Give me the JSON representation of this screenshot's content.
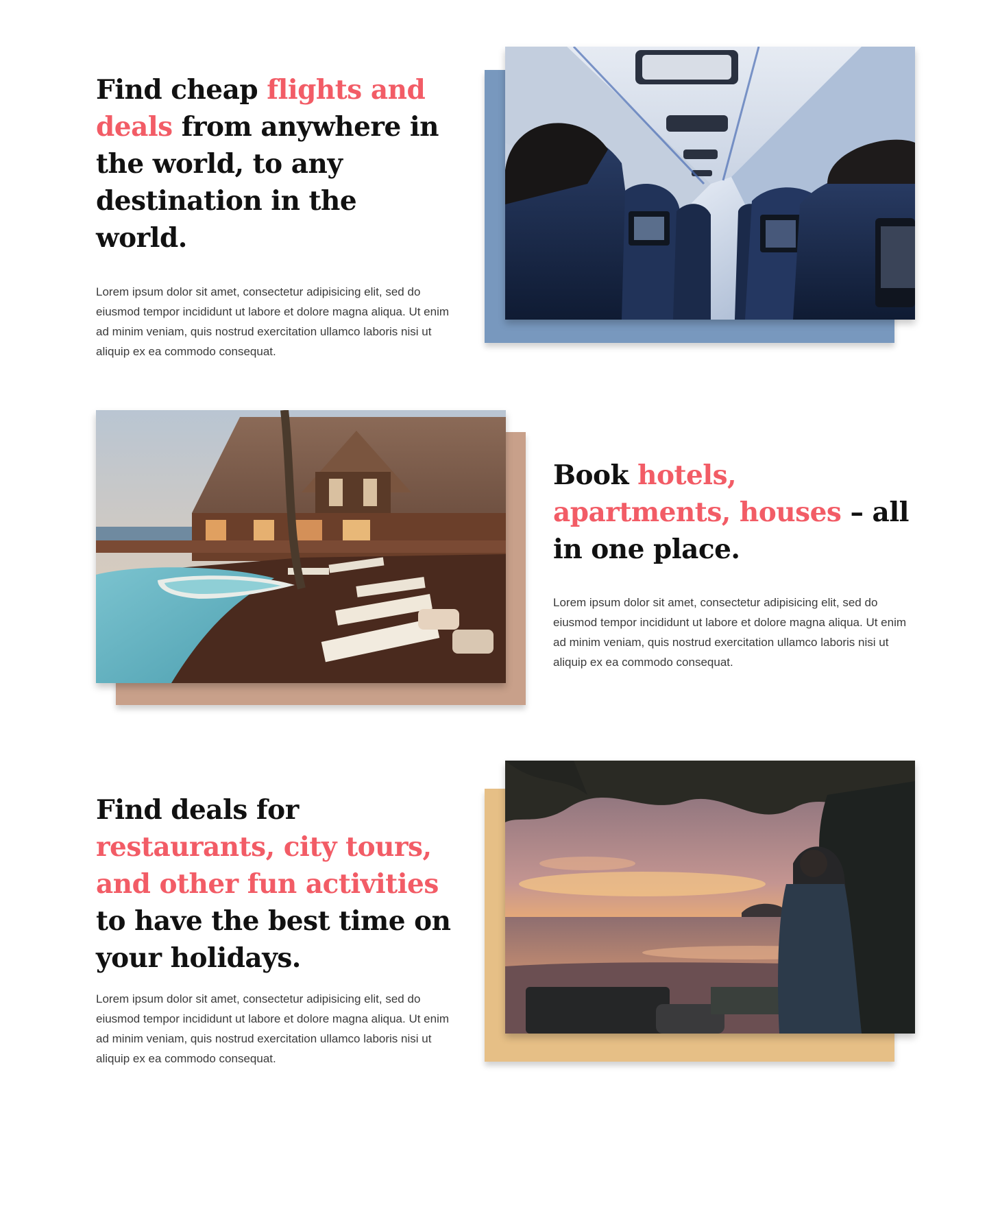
{
  "features": [
    {
      "heading_start": "Find cheap ",
      "heading_accent": "flights and deals",
      "heading_end": " from anywhere in the world, to any destination in the world.",
      "body": "Lorem ipsum dolor sit amet, consectetur adipisicing elit, sed do eiusmod tempor incididunt ut labore et dolore magna aliqua. Ut enim ad minim veniam, quis nostrud exercitation ullamco laboris nisi ut aliquip ex ea commodo consequat.",
      "backdrop_color": "#7898be",
      "photo_subject": "airplane-cabin"
    },
    {
      "heading_start": "Book ",
      "heading_accent": "hotels, apartments, houses",
      "heading_end": " – all in one place.",
      "body": "Lorem ipsum dolor sit amet, consectetur adipisicing elit, sed do eiusmod tempor incididunt ut labore et dolore magna aliqua. Ut enim ad minim veniam, quis nostrud exercitation ullamco laboris nisi ut aliquip ex ea commodo consequat.",
      "backdrop_color": "#c8a08a",
      "photo_subject": "resort-pool"
    },
    {
      "heading_start": "Find deals for ",
      "heading_accent": "restaurants, city tours, and other fun activities",
      "heading_end": " to have the best time on your holidays.",
      "body": "Lorem ipsum dolor sit amet, consectetur adipisicing elit, sed do eiusmod tempor incididunt ut labore et dolore magna aliqua. Ut enim ad minim veniam, quis nostrud exercitation ullamco laboris nisi ut aliquip ex ea commodo consequat.",
      "backdrop_color": "#e6bf86",
      "photo_subject": "beach-sunset"
    }
  ],
  "accent_color": "#f25c66"
}
